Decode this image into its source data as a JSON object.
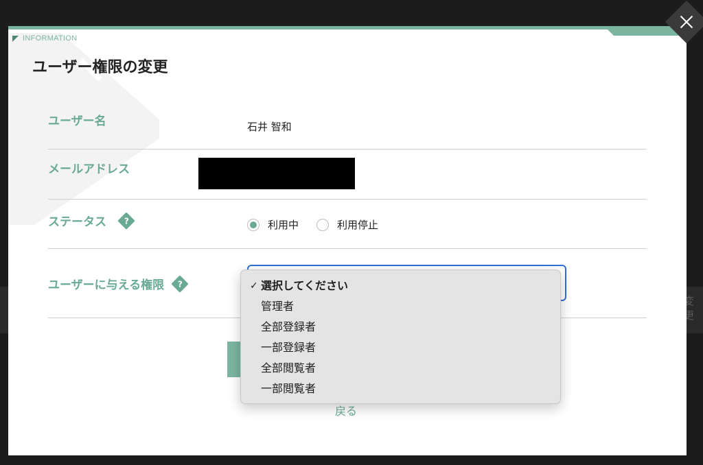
{
  "background": {
    "right_text": "変更"
  },
  "modal": {
    "info_label": "INFORMATION",
    "title": "ユーザー権限の変更",
    "accent_color": "#6aaa94",
    "fields": {
      "username": {
        "label": "ユーザー名",
        "value": "石井 智和"
      },
      "email": {
        "label": "メールアドレス"
      },
      "status": {
        "label": "ステータス",
        "options": [
          {
            "label": "利用中",
            "checked": true
          },
          {
            "label": "利用停止",
            "checked": false
          }
        ]
      },
      "permission": {
        "label": "ユーザーに与える権限"
      }
    },
    "help_icon_glyph": "?",
    "back_link": "戻る"
  },
  "dropdown": {
    "selected_index": 0,
    "check_glyph": "✓",
    "options": [
      "選択してください",
      "管理者",
      "全部登録者",
      "一部登録者",
      "全部閲覧者",
      "一部閲覧者"
    ]
  },
  "icons": {
    "close": "close-icon",
    "help": "help-icon",
    "info": "info-triangle-icon"
  }
}
